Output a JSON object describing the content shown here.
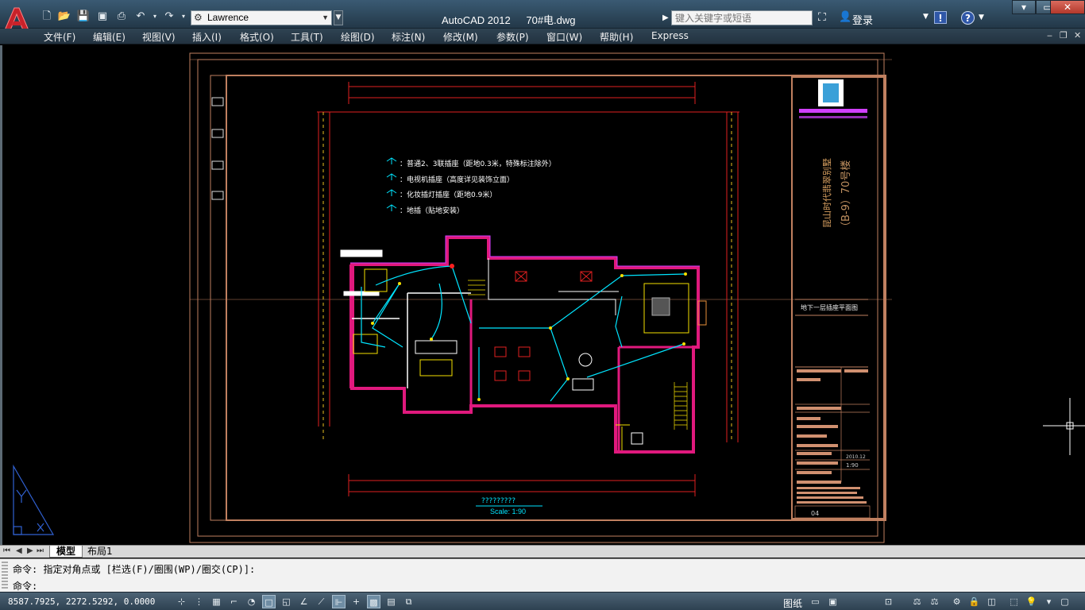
{
  "titlebar": {
    "workspace": "Lawrence",
    "app_title": "AutoCAD 2012",
    "file_name": "70#电.dwg",
    "search_placeholder": "键入关键字或短语",
    "login": "登录"
  },
  "menu": {
    "items": [
      "文件(F)",
      "编辑(E)",
      "视图(V)",
      "插入(I)",
      "格式(O)",
      "工具(T)",
      "绘图(D)",
      "标注(N)",
      "修改(M)",
      "参数(P)",
      "窗口(W)",
      "帮助(H)",
      "Express"
    ]
  },
  "drawing": {
    "legend": [
      "：普通2、3联插座（距地0.3米，特殊标注除外）",
      "：电视机插座（高度详见装饰立面）",
      "：化妆插灯插座（距地0.9米）",
      "：地插（贴地安装）"
    ],
    "caption_title": "?????????",
    "caption_scale": "Scale:   1:90",
    "titleblock_project": "昆山时代翡翠别墅",
    "titleblock_building": "（B-9）70号楼",
    "titleblock_sheet": "地下一层插座平面图",
    "titleblock_date": "2010.12",
    "titleblock_scale": "1:90",
    "titleblock_number": "04",
    "colors": {
      "wall": "#e0197d",
      "cyan": "#00e5ff",
      "yellow": "#f5e000",
      "red": "#ff2020",
      "frame": "#c08060",
      "white": "#ffffff",
      "magenta": "#d040ff"
    }
  },
  "tabs": {
    "model": "模型",
    "layout1": "布局1"
  },
  "command": {
    "line1": "命令: 指定对角点或 [栏选(F)/圈围(WP)/圈交(CP)]:",
    "line2": "命令:"
  },
  "status": {
    "coords": "8587.7925, 2272.5292, 0.0000",
    "paper": "图纸"
  }
}
